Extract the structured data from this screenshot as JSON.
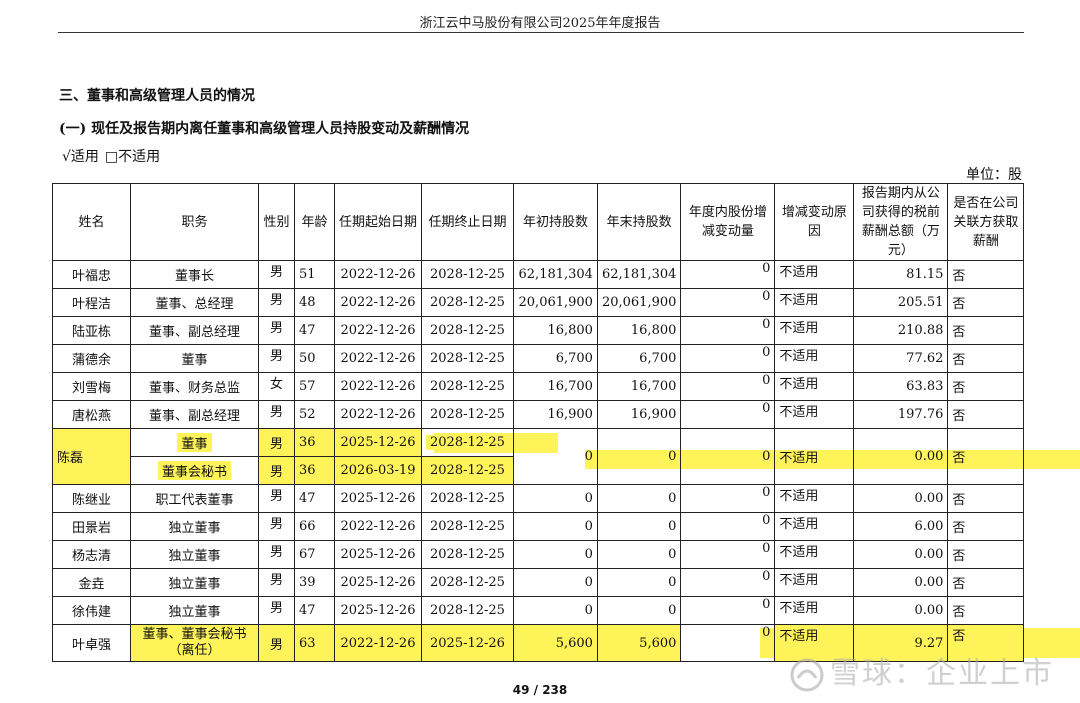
{
  "header": {
    "title": "浙江云中马股份有限公司2025年年度报告"
  },
  "section_title": "三、董事和高级管理人员的情况",
  "subsection_title": "(一)   现任及报告期内离任董事和高级管理人员持股变动及薪酬情况",
  "applicability": {
    "checked": "√适用",
    "unchecked": "□不适用"
  },
  "unit": "单位：股",
  "columns": {
    "name": "姓名",
    "position": "职务",
    "gender": "性别",
    "age": "年龄",
    "start": "任期起始日期",
    "end": "任期终止日期",
    "begin_shares": "年初持股数",
    "end_shares": "年末持股数",
    "change": "年度内股份增减变动量",
    "reason": "增减变动原因",
    "salary": "报告期内从公司获得的税前薪酬总额（万元）",
    "related": "是否在公司关联方获取薪酬"
  },
  "rows": [
    {
      "name": "叶福忠",
      "position": "董事长",
      "gender": "男",
      "age": "51",
      "start": "2022-12-26",
      "end": "2028-12-25",
      "begin_shares": "62,181,304",
      "end_shares": "62,181,304",
      "change": "0",
      "reason": "不适用",
      "salary": "81.15",
      "related": "否"
    },
    {
      "name": "叶程洁",
      "position": "董事、总经理",
      "gender": "男",
      "age": "48",
      "start": "2022-12-26",
      "end": "2028-12-25",
      "begin_shares": "20,061,900",
      "end_shares": "20,061,900",
      "change": "0",
      "reason": "不适用",
      "salary": "205.51",
      "related": "否"
    },
    {
      "name": "陆亚栋",
      "position": "董事、副总经理",
      "gender": "男",
      "age": "47",
      "start": "2022-12-26",
      "end": "2028-12-25",
      "begin_shares": "16,800",
      "end_shares": "16,800",
      "change": "0",
      "reason": "不适用",
      "salary": "210.88",
      "related": "否"
    },
    {
      "name": "蒲德余",
      "position": "董事",
      "gender": "男",
      "age": "50",
      "start": "2022-12-26",
      "end": "2028-12-25",
      "begin_shares": "6,700",
      "end_shares": "6,700",
      "change": "0",
      "reason": "不适用",
      "salary": "77.62",
      "related": "否"
    },
    {
      "name": "刘雪梅",
      "position": "董事、财务总监",
      "gender": "女",
      "age": "57",
      "start": "2022-12-26",
      "end": "2028-12-25",
      "begin_shares": "16,700",
      "end_shares": "16,700",
      "change": "0",
      "reason": "不适用",
      "salary": "63.83",
      "related": "否"
    },
    {
      "name": "唐松燕",
      "position": "董事、副总经理",
      "gender": "男",
      "age": "52",
      "start": "2022-12-26",
      "end": "2028-12-25",
      "begin_shares": "16,900",
      "end_shares": "16,900",
      "change": "0",
      "reason": "不适用",
      "salary": "197.76",
      "related": "否"
    }
  ],
  "chenlei": {
    "name": "陈磊",
    "sub1": {
      "position": "董事",
      "gender": "男",
      "age": "36",
      "start": "2025-12-26",
      "end": "2028-12-25"
    },
    "sub2": {
      "position": "董事会秘书",
      "gender": "男",
      "age": "36",
      "start": "2026-03-19",
      "end": "2028-12-25"
    },
    "begin_shares": "0",
    "end_shares": "0",
    "change": "0",
    "reason": "不适用",
    "salary": "0.00",
    "related": "否"
  },
  "rows2": [
    {
      "name": "陈继业",
      "position": "职工代表董事",
      "gender": "男",
      "age": "47",
      "start": "2025-12-26",
      "end": "2028-12-25",
      "begin_shares": "0",
      "end_shares": "0",
      "change": "0",
      "reason": "不适用",
      "salary": "0.00",
      "related": "否"
    },
    {
      "name": "田景岩",
      "position": "独立董事",
      "gender": "男",
      "age": "66",
      "start": "2022-12-26",
      "end": "2028-12-25",
      "begin_shares": "0",
      "end_shares": "0",
      "change": "0",
      "reason": "不适用",
      "salary": "6.00",
      "related": "否"
    },
    {
      "name": "杨志清",
      "position": "独立董事",
      "gender": "男",
      "age": "67",
      "start": "2025-12-26",
      "end": "2028-12-25",
      "begin_shares": "0",
      "end_shares": "0",
      "change": "0",
      "reason": "不适用",
      "salary": "0.00",
      "related": "否"
    },
    {
      "name": "金垚",
      "position": "独立董事",
      "gender": "男",
      "age": "39",
      "start": "2025-12-26",
      "end": "2028-12-25",
      "begin_shares": "0",
      "end_shares": "0",
      "change": "0",
      "reason": "不适用",
      "salary": "0.00",
      "related": "否"
    },
    {
      "name": "徐伟建",
      "position": "独立董事",
      "gender": "男",
      "age": "47",
      "start": "2025-12-26",
      "end": "2028-12-25",
      "begin_shares": "0",
      "end_shares": "0",
      "change": "0",
      "reason": "不适用",
      "salary": "0.00",
      "related": "否"
    }
  ],
  "last": {
    "name": "叶卓强",
    "position_line1": "董事、董事会秘书",
    "position_line2": "（离任）",
    "gender": "男",
    "age": "63",
    "start": "2022-12-26",
    "end": "2025-12-26",
    "begin_shares": "5,600",
    "end_shares": "5,600",
    "change": "0",
    "reason": "不适用",
    "salary": "9.27",
    "related": "否"
  },
  "footer": {
    "page": "49 / 238"
  },
  "watermark": {
    "text": "雪球：企业上市"
  },
  "colors": {
    "highlight": "#fff35a"
  }
}
